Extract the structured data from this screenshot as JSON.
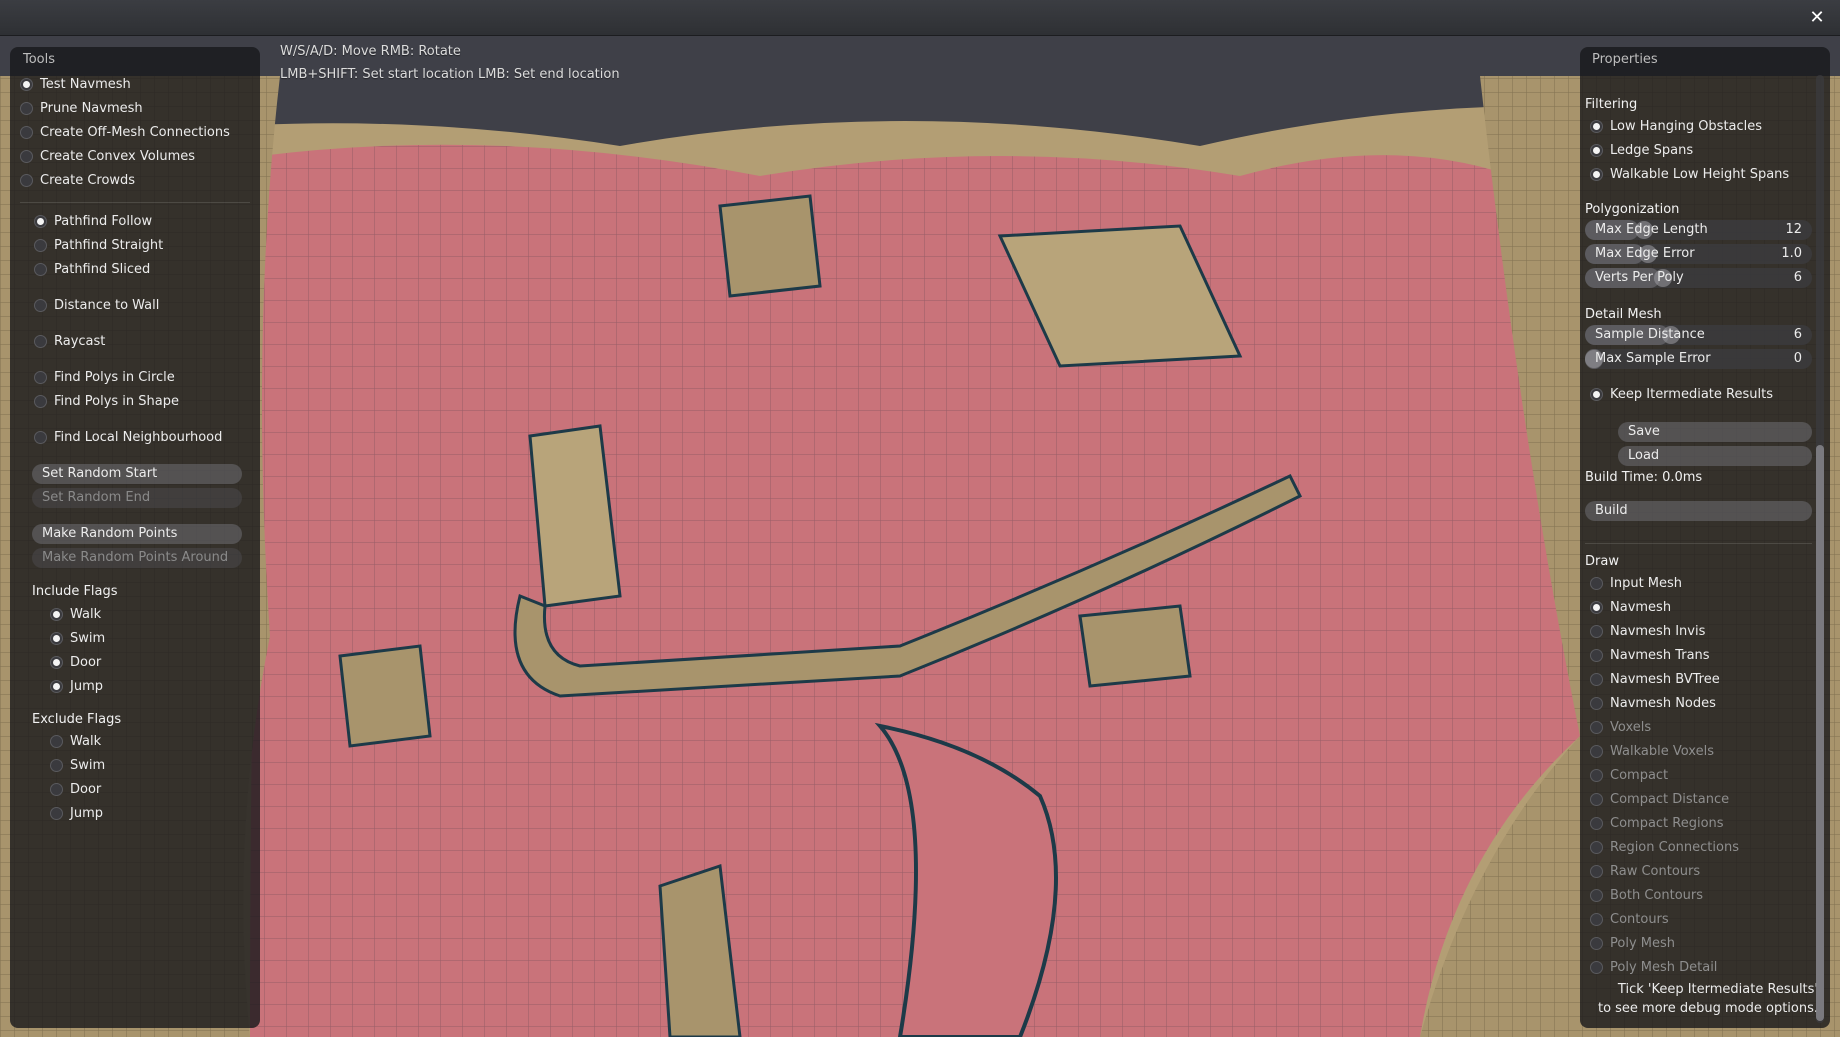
{
  "window": {
    "close_glyph": "✕"
  },
  "viewport": {
    "hint_line1": "W/S/A/D: Move  RMB: Rotate",
    "hint_line2": "LMB+SHIFT: Set start location  LMB: Set end location"
  },
  "tools": {
    "title": "Tools",
    "tool_items": [
      {
        "label": "Test Navmesh",
        "checked": true
      },
      {
        "label": "Prune Navmesh",
        "checked": false
      },
      {
        "label": "Create Off-Mesh Connections",
        "checked": false
      },
      {
        "label": "Create Convex Volumes",
        "checked": false
      },
      {
        "label": "Create Crowds",
        "checked": false
      }
    ],
    "modes": [
      {
        "label": "Pathfind Follow",
        "checked": true
      },
      {
        "label": "Pathfind Straight",
        "checked": false
      },
      {
        "label": "Pathfind Sliced",
        "checked": false
      },
      {
        "label": "Distance to Wall",
        "checked": false
      },
      {
        "label": "Raycast",
        "checked": false
      },
      {
        "label": "Find Polys in Circle",
        "checked": false
      },
      {
        "label": "Find Polys in Shape",
        "checked": false
      },
      {
        "label": "Find Local Neighbourhood",
        "checked": false
      }
    ],
    "buttons": [
      {
        "label": "Set Random Start",
        "enabled": true
      },
      {
        "label": "Set Random End",
        "enabled": false
      },
      {
        "label": "Make Random Points",
        "enabled": true
      },
      {
        "label": "Make Random Points Around",
        "enabled": false
      }
    ],
    "include_flags_title": "Include Flags",
    "include_flags": [
      {
        "label": "Walk",
        "checked": true
      },
      {
        "label": "Swim",
        "checked": true
      },
      {
        "label": "Door",
        "checked": true
      },
      {
        "label": "Jump",
        "checked": true
      }
    ],
    "exclude_flags_title": "Exclude Flags",
    "exclude_flags": [
      {
        "label": "Walk",
        "checked": false
      },
      {
        "label": "Swim",
        "checked": false
      },
      {
        "label": "Door",
        "checked": false
      },
      {
        "label": "Jump",
        "checked": false
      }
    ]
  },
  "properties": {
    "title": "Properties",
    "filtering_title": "Filtering",
    "filtering": [
      {
        "label": "Low Hanging Obstacles",
        "checked": true
      },
      {
        "label": "Ledge Spans",
        "checked": true
      },
      {
        "label": "Walkable Low Height Spans",
        "checked": true
      }
    ],
    "polygonization_title": "Polygonization",
    "polygonization": [
      {
        "label": "Max Edge Length",
        "value": "12",
        "level": 0.24
      },
      {
        "label": "Max Edge Error",
        "value": "1.0",
        "level": 0.26
      },
      {
        "label": "Verts Per Poly",
        "value": "6",
        "level": 0.33
      }
    ],
    "detail_title": "Detail Mesh",
    "detail": [
      {
        "label": "Sample Distance",
        "value": "6",
        "level": 0.37
      },
      {
        "label": "Max Sample Error",
        "value": "0",
        "level": 0.0
      }
    ],
    "keep_results": {
      "label": "Keep Itermediate Results",
      "checked": true
    },
    "save_label": "Save",
    "load_label": "Load",
    "build_time": "Build Time: 0.0ms",
    "build_label": "Build",
    "draw_title": "Draw",
    "draw": [
      {
        "label": "Input Mesh",
        "checked": false,
        "enabled": true
      },
      {
        "label": "Navmesh",
        "checked": true,
        "enabled": true
      },
      {
        "label": "Navmesh Invis",
        "checked": false,
        "enabled": true
      },
      {
        "label": "Navmesh Trans",
        "checked": false,
        "enabled": true
      },
      {
        "label": "Navmesh BVTree",
        "checked": false,
        "enabled": true
      },
      {
        "label": "Navmesh Nodes",
        "checked": false,
        "enabled": true
      },
      {
        "label": "Voxels",
        "checked": false,
        "enabled": false
      },
      {
        "label": "Walkable Voxels",
        "checked": false,
        "enabled": false
      },
      {
        "label": "Compact",
        "checked": false,
        "enabled": false
      },
      {
        "label": "Compact Distance",
        "checked": false,
        "enabled": false
      },
      {
        "label": "Compact Regions",
        "checked": false,
        "enabled": false
      },
      {
        "label": "Region Connections",
        "checked": false,
        "enabled": false
      },
      {
        "label": "Raw Contours",
        "checked": false,
        "enabled": false
      },
      {
        "label": "Both Contours",
        "checked": false,
        "enabled": false
      },
      {
        "label": "Contours",
        "checked": false,
        "enabled": false
      },
      {
        "label": "Poly Mesh",
        "checked": false,
        "enabled": false
      },
      {
        "label": "Poly Mesh Detail",
        "checked": false,
        "enabled": false
      }
    ],
    "info_line1": "Tick 'Keep Itermediate Results'",
    "info_line2": "to see more debug mode options."
  },
  "colors": {
    "navmesh": "#c9737a",
    "terrain": "#a8946c",
    "sky": "#3f4048"
  }
}
